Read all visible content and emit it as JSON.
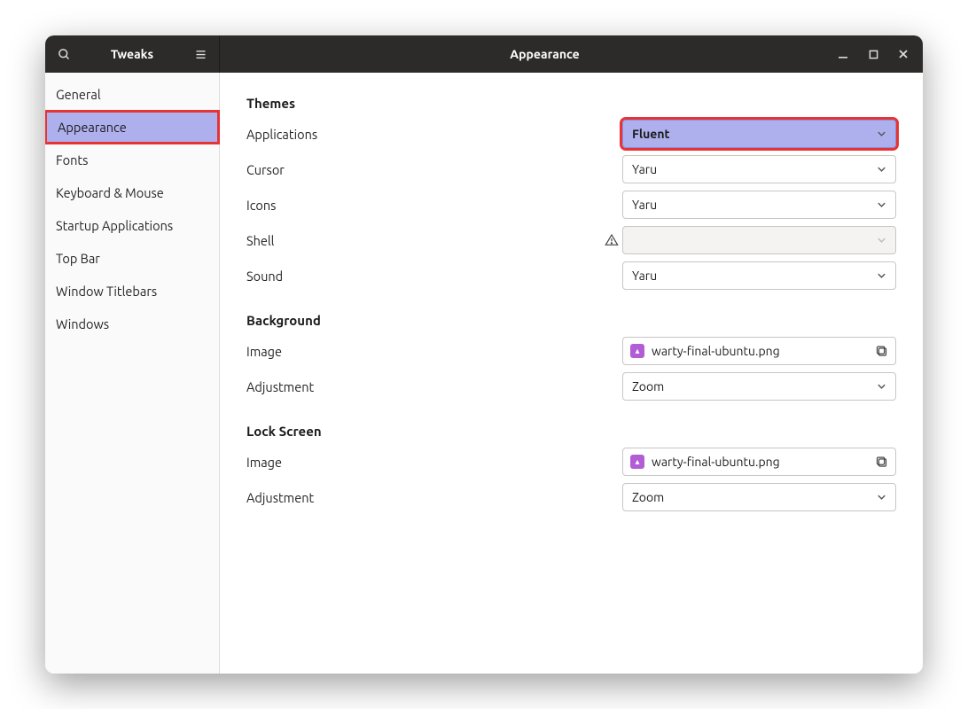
{
  "titlebar": {
    "app_name": "Tweaks",
    "page_title": "Appearance"
  },
  "sidebar": {
    "items": [
      {
        "label": "General",
        "active": false
      },
      {
        "label": "Appearance",
        "active": true,
        "highlighted": true
      },
      {
        "label": "Fonts",
        "active": false
      },
      {
        "label": "Keyboard & Mouse",
        "active": false
      },
      {
        "label": "Startup Applications",
        "active": false
      },
      {
        "label": "Top Bar",
        "active": false
      },
      {
        "label": "Window Titlebars",
        "active": false
      },
      {
        "label": "Windows",
        "active": false
      }
    ]
  },
  "sections": {
    "themes": {
      "title": "Themes",
      "applications": {
        "label": "Applications",
        "value": "Fluent",
        "highlighted": true
      },
      "cursor": {
        "label": "Cursor",
        "value": "Yaru"
      },
      "icons": {
        "label": "Icons",
        "value": "Yaru"
      },
      "shell": {
        "label": "Shell",
        "value": "",
        "disabled": true,
        "warning": true
      },
      "sound": {
        "label": "Sound",
        "value": "Yaru"
      }
    },
    "background": {
      "title": "Background",
      "image": {
        "label": "Image",
        "value": "warty-final-ubuntu.png"
      },
      "adjustment": {
        "label": "Adjustment",
        "value": "Zoom"
      }
    },
    "lockscreen": {
      "title": "Lock Screen",
      "image": {
        "label": "Image",
        "value": "warty-final-ubuntu.png"
      },
      "adjustment": {
        "label": "Adjustment",
        "value": "Zoom"
      }
    }
  }
}
